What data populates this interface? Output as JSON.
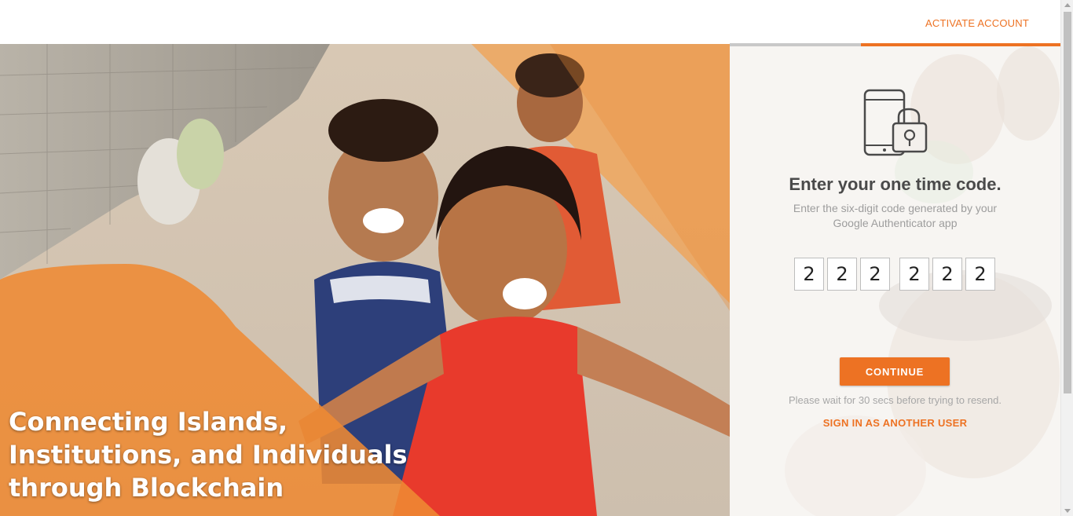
{
  "header": {
    "activate_account_label": "ACTIVATE ACCOUNT"
  },
  "progress": {
    "completed_fraction": 0.6
  },
  "hero": {
    "caption_line1": "Connecting Islands,",
    "caption_line2": "Institutions, and Individuals",
    "caption_line3": "through Blockchain"
  },
  "otp_form": {
    "icon": "tablet-lock-icon",
    "title": "Enter your one time code.",
    "subtitle_line1": "Enter the six-digit code generated by your",
    "subtitle_line2": "Google Authenticator app",
    "digits": [
      "2",
      "2",
      "2",
      "2",
      "2",
      "2"
    ],
    "continue_label": "CONTINUE",
    "wait_message": "Please wait for 30 secs before trying to resend.",
    "sign_in_other_label": "SIGN IN AS ANOTHER USER"
  },
  "colors": {
    "accent": "#ed7223",
    "title_text": "#4a4a4a",
    "muted_text": "#9d9d9d"
  }
}
